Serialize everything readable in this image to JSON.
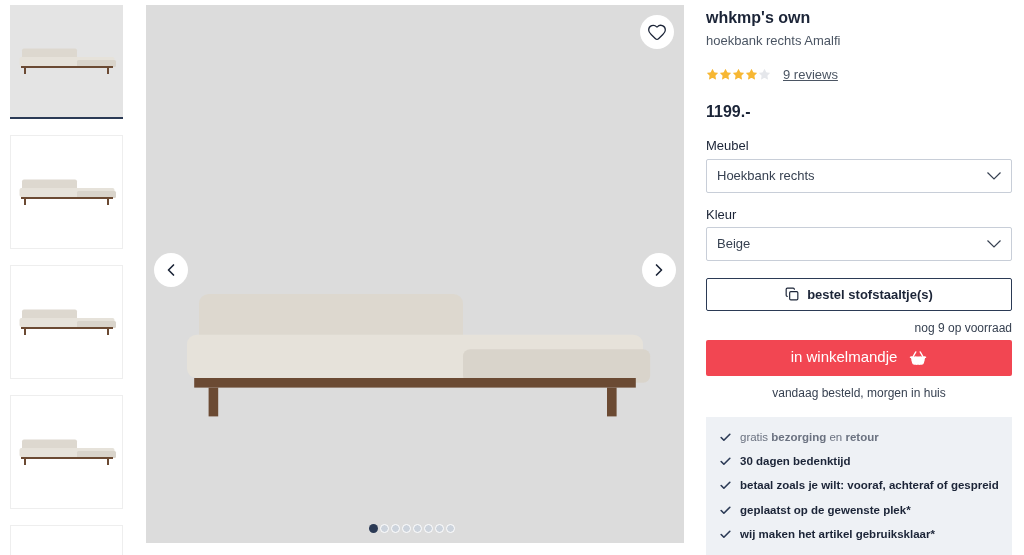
{
  "thumbnails": [
    {
      "selected": true
    },
    {
      "selected": false
    },
    {
      "selected": false
    },
    {
      "selected": false
    },
    {
      "selected": false
    }
  ],
  "gallery": {
    "dots": [
      {
        "selected": true
      },
      {
        "selected": false
      },
      {
        "selected": false
      },
      {
        "selected": false
      },
      {
        "selected": false
      },
      {
        "selected": false
      },
      {
        "selected": false
      },
      {
        "selected": false
      }
    ]
  },
  "product": {
    "brand": "whkmp's own",
    "name": "hoekbank rechts Amalfi",
    "stars": 4,
    "reviews": "9 reviews",
    "price": "1199.-"
  },
  "options": [
    {
      "label": "Meubel",
      "value": "Hoekbank rechts"
    },
    {
      "label": "Kleur",
      "value": "Beige"
    }
  ],
  "swatch_button": "bestel stofstaaltje(s)",
  "stock": "nog 9 op voorraad",
  "cart_button": "in winkelmandje",
  "delivery": "vandaag besteld, morgen in huis",
  "benefits": [
    "gratis **bezorging** en **retour**",
    "30 dagen bedenktijd",
    "betaal zoals je wilt: vooraf, achteraf of gespreid",
    "geplaatst op de gewenste plek*",
    "wij maken het artikel gebruiksklaar*"
  ]
}
